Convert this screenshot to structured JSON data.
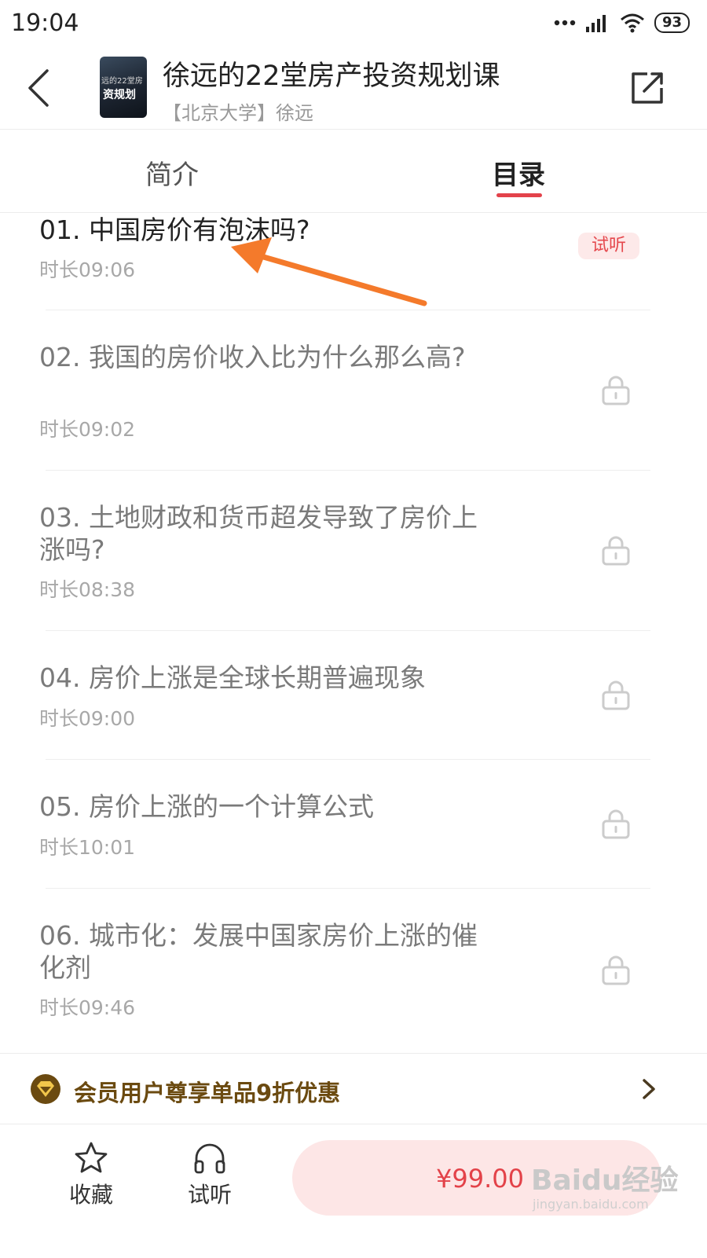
{
  "status_bar": {
    "time": "19:04",
    "battery": "93"
  },
  "header": {
    "title": "徐远的22堂房产投资规划课",
    "author": "【北京大学】徐远",
    "cover_text_1": "远的22堂房",
    "cover_text_2": "资规划"
  },
  "tabs": {
    "intro": "简介",
    "catalog": "目录"
  },
  "episodes": [
    {
      "title": "01. 中国房价有泡沫吗?",
      "duration": "时长09:06",
      "badge": "试听"
    },
    {
      "title": "02. 我国的房价收入比为什么那么高?",
      "duration": "时长09:02"
    },
    {
      "title": "03. 土地财政和货币超发导致了房价上涨吗?",
      "duration": "时长08:38"
    },
    {
      "title": "04. 房价上涨是全球长期普遍现象",
      "duration": "时长09:00"
    },
    {
      "title": "05. 房价上涨的一个计算公式",
      "duration": "时长10:01"
    },
    {
      "title": "06. 城市化：发展中国家房价上涨的催化剂",
      "duration": "时长09:46"
    }
  ],
  "member_bar": {
    "text": "会员用户尊享单品9折优惠"
  },
  "bottom_bar": {
    "favorite_label": "收藏",
    "trial_label": "试听",
    "price": "¥99.00"
  },
  "watermark": {
    "main": "Baidu经验",
    "sub": "jingyan.baidu.com"
  },
  "colors": {
    "accent": "#e3424b",
    "member_gold": "#6b4a10",
    "buy_bg": "#fde6e6"
  }
}
